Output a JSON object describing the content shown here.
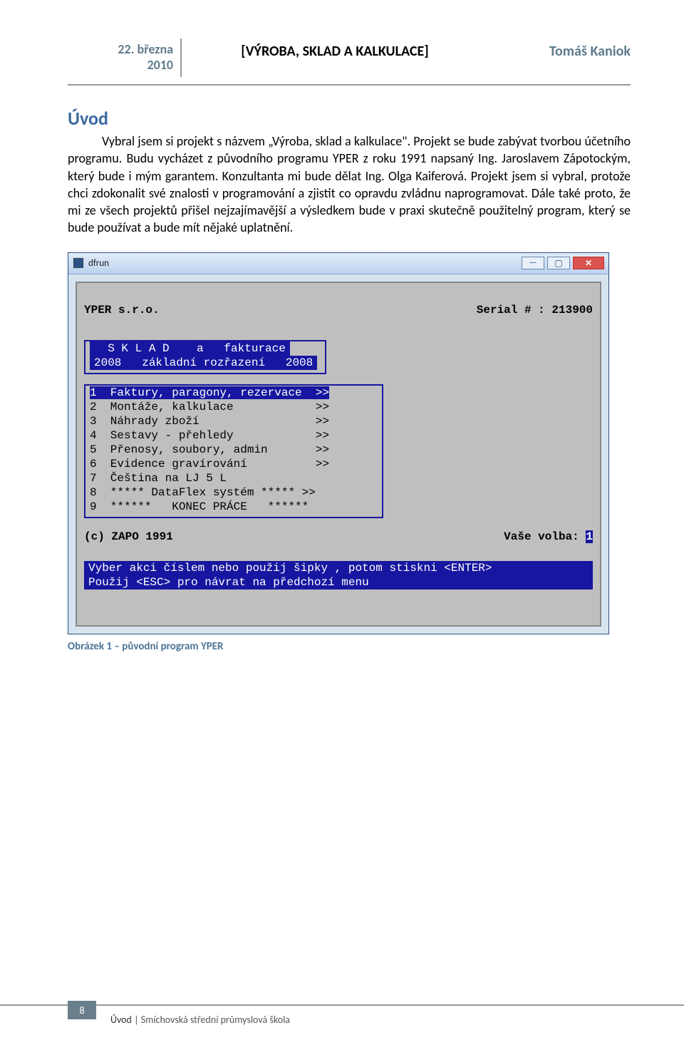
{
  "header": {
    "date_line1": "22. března",
    "date_line2": "2010",
    "center_title": "[VÝROBA, SKLAD A KALKULACE]",
    "author": "Tomáš Kaniok"
  },
  "section": {
    "title": "Úvod",
    "paragraph": "Vybral jsem si projekt s názvem „Výroba, sklad a kalkulace\". Projekt se bude zabývat tvorbou účetního programu. Budu vycházet z původního programu YPER z roku 1991 napsaný Ing. Jaroslavem Zápotockým, který bude i mým garantem. Konzultanta mi bude dělat Ing. Olga Kaiferová. Projekt jsem si vybral, protože chci zdokonalit své znalosti v programování a zjistit co opravdu zvládnu naprogramovat. Dále také proto, že mi ze všech projektů přišel nejzajímavější a výsledkem bude v praxi skutečně použitelný program, který se bude používat a bude mít nějaké uplatnění."
  },
  "window": {
    "title": "dfrun",
    "dos": {
      "company": "YPER s.r.o.",
      "serial_label": "Serial # : 213900",
      "box_title_l1": "  S K L A D    a   fakturace",
      "box_title_l2": "2008   základní rozřazení   2008",
      "menu": [
        {
          "n": "1",
          "label": "Faktury, paragony, rezervace",
          "suffix": ">>",
          "sel": true
        },
        {
          "n": "2",
          "label": "Montáže, kalkulace",
          "suffix": ">>"
        },
        {
          "n": "3",
          "label": "Náhrady zboží",
          "suffix": ">>"
        },
        {
          "n": "4",
          "label": "Sestavy - přehledy",
          "suffix": ">>"
        },
        {
          "n": "5",
          "label": "Přenosy, soubory, admin",
          "suffix": ">>"
        },
        {
          "n": "6",
          "label": "Evidence gravírování",
          "suffix": ">>"
        },
        {
          "n": "7",
          "label": "Čeština na LJ 5 L",
          "suffix": ""
        },
        {
          "n": "8",
          "label": "***** DataFlex systém ***** >>",
          "suffix": ""
        },
        {
          "n": "9",
          "label": "******   KONEC PRÁCE   ******",
          "suffix": ""
        }
      ],
      "copyright": "(c) ZAPO 1991",
      "prompt_label": "Vaše volba:",
      "prompt_value": "1",
      "hint1": "Vyber akci číslem nebo použij šipky , potom stiskni <ENTER>",
      "hint2": "Použij <ESC> pro návrat na předchozí menu"
    }
  },
  "caption": "Obrázek 1 – původní program YPER",
  "footer": {
    "page_number": "8",
    "lead": "Úvod",
    "trail": " | Smíchovská střední průmyslová škola"
  }
}
